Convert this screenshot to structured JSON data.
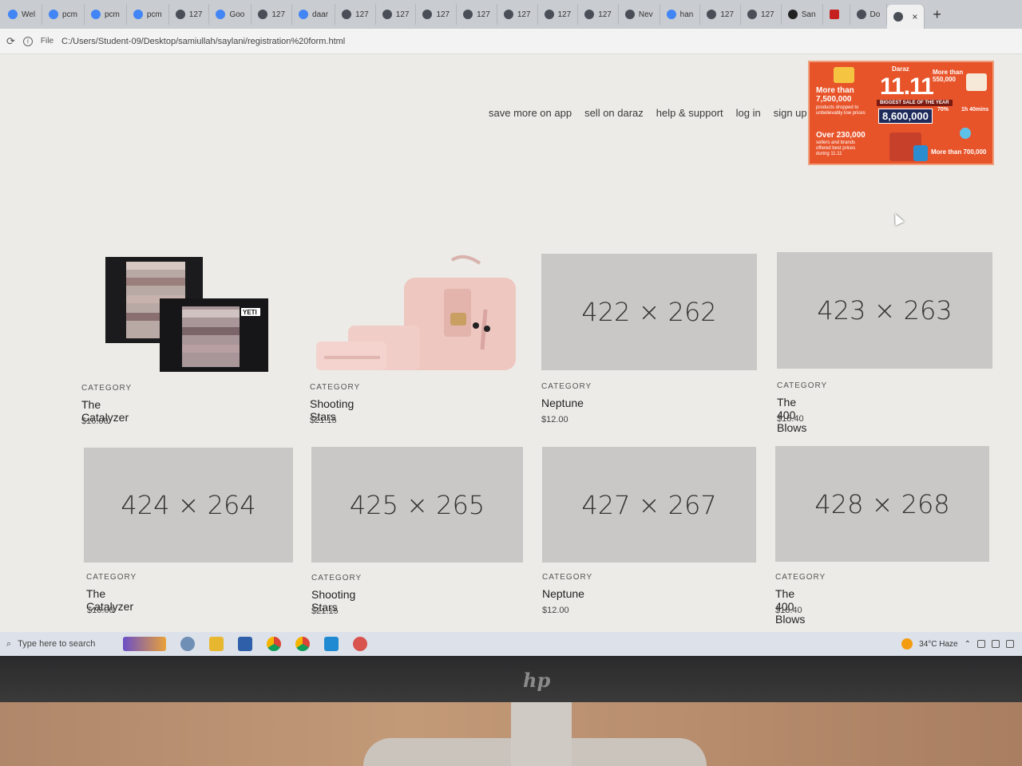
{
  "browser": {
    "tabs": [
      {
        "label": "Wel",
        "icon": "docs-icon"
      },
      {
        "label": "pcm",
        "icon": "drive-icon"
      },
      {
        "label": "pcm",
        "icon": "drive-icon"
      },
      {
        "label": "pcm",
        "icon": "drive-icon"
      },
      {
        "label": "127",
        "icon": "globe-icon"
      },
      {
        "label": "Goo",
        "icon": "google-icon"
      },
      {
        "label": "127",
        "icon": "globe-icon"
      },
      {
        "label": "daar",
        "icon": "google-icon"
      },
      {
        "label": "127",
        "icon": "globe-icon"
      },
      {
        "label": "127",
        "icon": "globe-icon"
      },
      {
        "label": "127",
        "icon": "globe-icon"
      },
      {
        "label": "127",
        "icon": "globe-icon"
      },
      {
        "label": "127",
        "icon": "globe-icon"
      },
      {
        "label": "127",
        "icon": "globe-icon"
      },
      {
        "label": "127",
        "icon": "globe-icon"
      },
      {
        "label": "Nev",
        "icon": "globe-icon"
      },
      {
        "label": "han",
        "icon": "google-icon"
      },
      {
        "label": "127",
        "icon": "globe-icon"
      },
      {
        "label": "127",
        "icon": "globe-icon"
      },
      {
        "label": "San",
        "icon": "github-icon"
      },
      {
        "label": "",
        "icon": "gmail-icon"
      },
      {
        "label": "Do",
        "icon": "globe-icon"
      }
    ],
    "active_tab_close": "×",
    "new_tab": "+",
    "address": {
      "file_label": "File",
      "url": "C:/Users/Student-09/Desktop/samiullah/saylani/registration%20form.html"
    }
  },
  "nav": {
    "items": [
      "save more on app",
      "sell on daraz",
      "help & support",
      "log in",
      "sign up"
    ]
  },
  "banner": {
    "brand": "Daraz",
    "headline": "11.11",
    "sale_tag": "BIGGEST SALE OF THE YEAR",
    "big_number": "8,600,000",
    "left_top": "More than 7,500,000",
    "left_top_sub": "products dropped to unbelievably low prices",
    "left_bottom": "Over 230,000",
    "left_bottom_sub": "sellers and brands offered best prices during 11.11",
    "right_top": "More than 550,000",
    "right_mid_a": "70%",
    "right_mid_b": "1h 40mins",
    "right_bottom": "More than 700,000"
  },
  "products": [
    {
      "category": "CATEGORY",
      "title": "The Catalyzer",
      "price": "$16.00",
      "image": "storage-bags"
    },
    {
      "category": "CATEGORY",
      "title": "Shooting Stars",
      "price": "$21.15",
      "image": "pink-handbag"
    },
    {
      "category": "CATEGORY",
      "title": "Neptune",
      "price": "$12.00",
      "placeholder": "422 × 262"
    },
    {
      "category": "CATEGORY",
      "title": "The 400 Blows",
      "price": "$18.40",
      "placeholder": "423 × 263"
    },
    {
      "category": "CATEGORY",
      "title": "The Catalyzer",
      "price": "$16.00",
      "placeholder": "424 × 264"
    },
    {
      "category": "CATEGORY",
      "title": "Shooting Stars",
      "price": "$21.15",
      "placeholder": "425 × 265"
    },
    {
      "category": "CATEGORY",
      "title": "Neptune",
      "price": "$12.00",
      "placeholder": "427 × 267"
    },
    {
      "category": "CATEGORY",
      "title": "The 400 Blows",
      "price": "$18.40",
      "placeholder": "428 × 268"
    }
  ],
  "taskbar": {
    "search_placeholder": "Type here to search",
    "weather": "34°C  Haze"
  },
  "colors": {
    "page_bg": "#ecebe7",
    "placeholder_bg": "#c9c8c6",
    "banner_bg": "#e8542a",
    "taskbar_bg": "#dde2ea"
  }
}
